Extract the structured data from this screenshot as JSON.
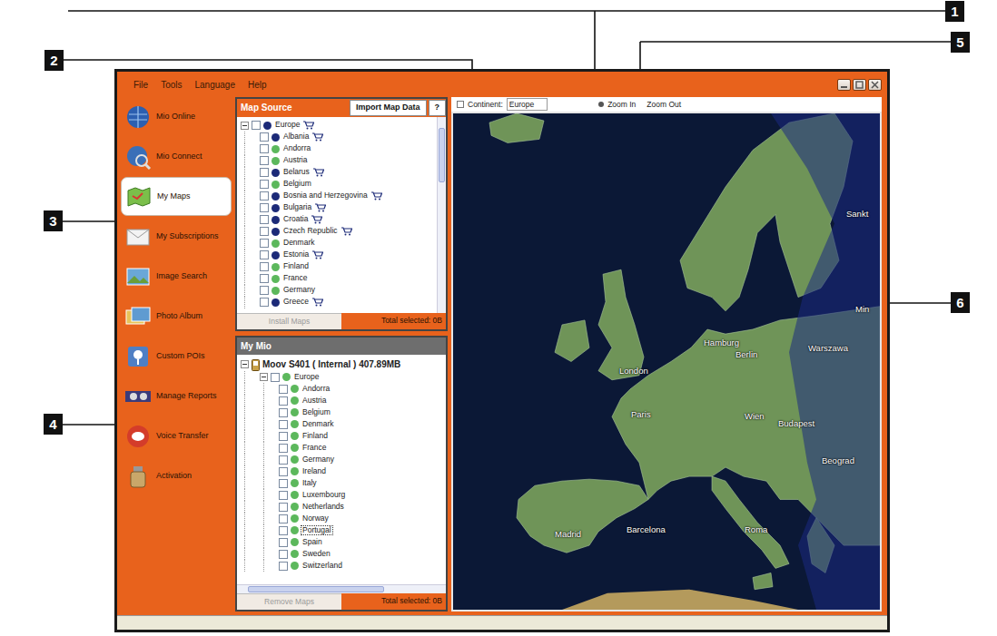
{
  "callouts": [
    {
      "number": "1"
    },
    {
      "number": "2"
    },
    {
      "number": "3"
    },
    {
      "number": "4"
    },
    {
      "number": "5"
    },
    {
      "number": "6"
    }
  ],
  "window": {
    "menu": [
      "File",
      "Tools",
      "Language",
      "Help"
    ]
  },
  "sidebar": {
    "items": [
      {
        "label": "Mio Online",
        "selected": false
      },
      {
        "label": "Mio Connect",
        "selected": false
      },
      {
        "label": "My Maps",
        "selected": true
      },
      {
        "label": "My Subscriptions",
        "selected": false
      },
      {
        "label": "Image Search",
        "selected": false
      },
      {
        "label": "Photo Album",
        "selected": false
      },
      {
        "label": "Custom POIs",
        "selected": false
      },
      {
        "label": "Manage Reports",
        "selected": false
      },
      {
        "label": "Voice Transfer",
        "selected": false
      },
      {
        "label": "Activation",
        "selected": false
      }
    ]
  },
  "toolbar": {
    "continent_label": "Continent:",
    "continent_value": "Europe",
    "zoom_in": "Zoom In",
    "zoom_out": "Zoom Out"
  },
  "map_source": {
    "title": "Map Source",
    "import_button": "Import Map Data",
    "help_button": "?",
    "root": {
      "label": "Europe",
      "checked": false,
      "purchasable": true,
      "color": "#1c2a78"
    },
    "items": [
      {
        "label": "Albania",
        "checked": false,
        "purchasable": true,
        "color": "#1c2a78"
      },
      {
        "label": "Andorra",
        "checked": false,
        "purchasable": false,
        "color": "#5cb85c"
      },
      {
        "label": "Austria",
        "checked": false,
        "purchasable": false,
        "color": "#5cb85c"
      },
      {
        "label": "Belarus",
        "checked": false,
        "purchasable": true,
        "color": "#1c2a78"
      },
      {
        "label": "Belgium",
        "checked": false,
        "purchasable": false,
        "color": "#5cb85c"
      },
      {
        "label": "Bosnia and Herzegovina",
        "checked": false,
        "purchasable": true,
        "color": "#1c2a78"
      },
      {
        "label": "Bulgaria",
        "checked": false,
        "purchasable": true,
        "color": "#1c2a78"
      },
      {
        "label": "Croatia",
        "checked": false,
        "purchasable": true,
        "color": "#1c2a78"
      },
      {
        "label": "Czech Republic",
        "checked": false,
        "purchasable": true,
        "color": "#1c2a78"
      },
      {
        "label": "Denmark",
        "checked": false,
        "purchasable": false,
        "color": "#5cb85c"
      },
      {
        "label": "Estonia",
        "checked": false,
        "purchasable": true,
        "color": "#1c2a78"
      },
      {
        "label": "Finland",
        "checked": false,
        "purchasable": false,
        "color": "#5cb85c"
      },
      {
        "label": "France",
        "checked": false,
        "purchasable": false,
        "color": "#5cb85c"
      },
      {
        "label": "Germany",
        "checked": false,
        "purchasable": false,
        "color": "#5cb85c"
      },
      {
        "label": "Greece",
        "checked": false,
        "purchasable": true,
        "color": "#1c2a78"
      }
    ],
    "install_button": "Install Maps",
    "install_disabled": true,
    "total": "Total selected: 0B"
  },
  "my_mio": {
    "title": "My Mio",
    "device": "Moov S401 ( Internal ) 407.89MB",
    "group": {
      "label": "Europe",
      "checked": false,
      "color": "#5cb85c"
    },
    "items": [
      {
        "label": "Andorra",
        "checked": false,
        "selected": false,
        "color": "#5cb85c"
      },
      {
        "label": "Austria",
        "checked": false,
        "selected": false,
        "color": "#5cb85c"
      },
      {
        "label": "Belgium",
        "checked": false,
        "selected": false,
        "color": "#5cb85c"
      },
      {
        "label": "Denmark",
        "checked": false,
        "selected": false,
        "color": "#5cb85c"
      },
      {
        "label": "Finland",
        "checked": false,
        "selected": false,
        "color": "#5cb85c"
      },
      {
        "label": "France",
        "checked": false,
        "selected": false,
        "color": "#5cb85c"
      },
      {
        "label": "Germany",
        "checked": false,
        "selected": false,
        "color": "#5cb85c"
      },
      {
        "label": "Ireland",
        "checked": false,
        "selected": false,
        "color": "#5cb85c"
      },
      {
        "label": "Italy",
        "checked": false,
        "selected": false,
        "color": "#5cb85c"
      },
      {
        "label": "Luxembourg",
        "checked": false,
        "selected": false,
        "color": "#5cb85c"
      },
      {
        "label": "Netherlands",
        "checked": false,
        "selected": false,
        "color": "#5cb85c"
      },
      {
        "label": "Norway",
        "checked": false,
        "selected": false,
        "color": "#5cb85c"
      },
      {
        "label": "Portugal",
        "checked": false,
        "selected": true,
        "color": "#5cb85c"
      },
      {
        "label": "Spain",
        "checked": false,
        "selected": false,
        "color": "#5cb85c"
      },
      {
        "label": "Sweden",
        "checked": false,
        "selected": false,
        "color": "#5cb85c"
      },
      {
        "label": "Switzerland",
        "checked": false,
        "selected": false,
        "color": "#5cb85c"
      }
    ],
    "remove_button": "Remove Maps",
    "remove_disabled": true,
    "total": "Total selected: 0B"
  },
  "map": {
    "labels": [
      "Sankt",
      "Min",
      "Warszawa",
      "Hamburg",
      "Berlin",
      "London",
      "Paris",
      "Wien",
      "Budapest",
      "Beograd",
      "Madrid",
      "Barcelona",
      "Roma"
    ]
  }
}
